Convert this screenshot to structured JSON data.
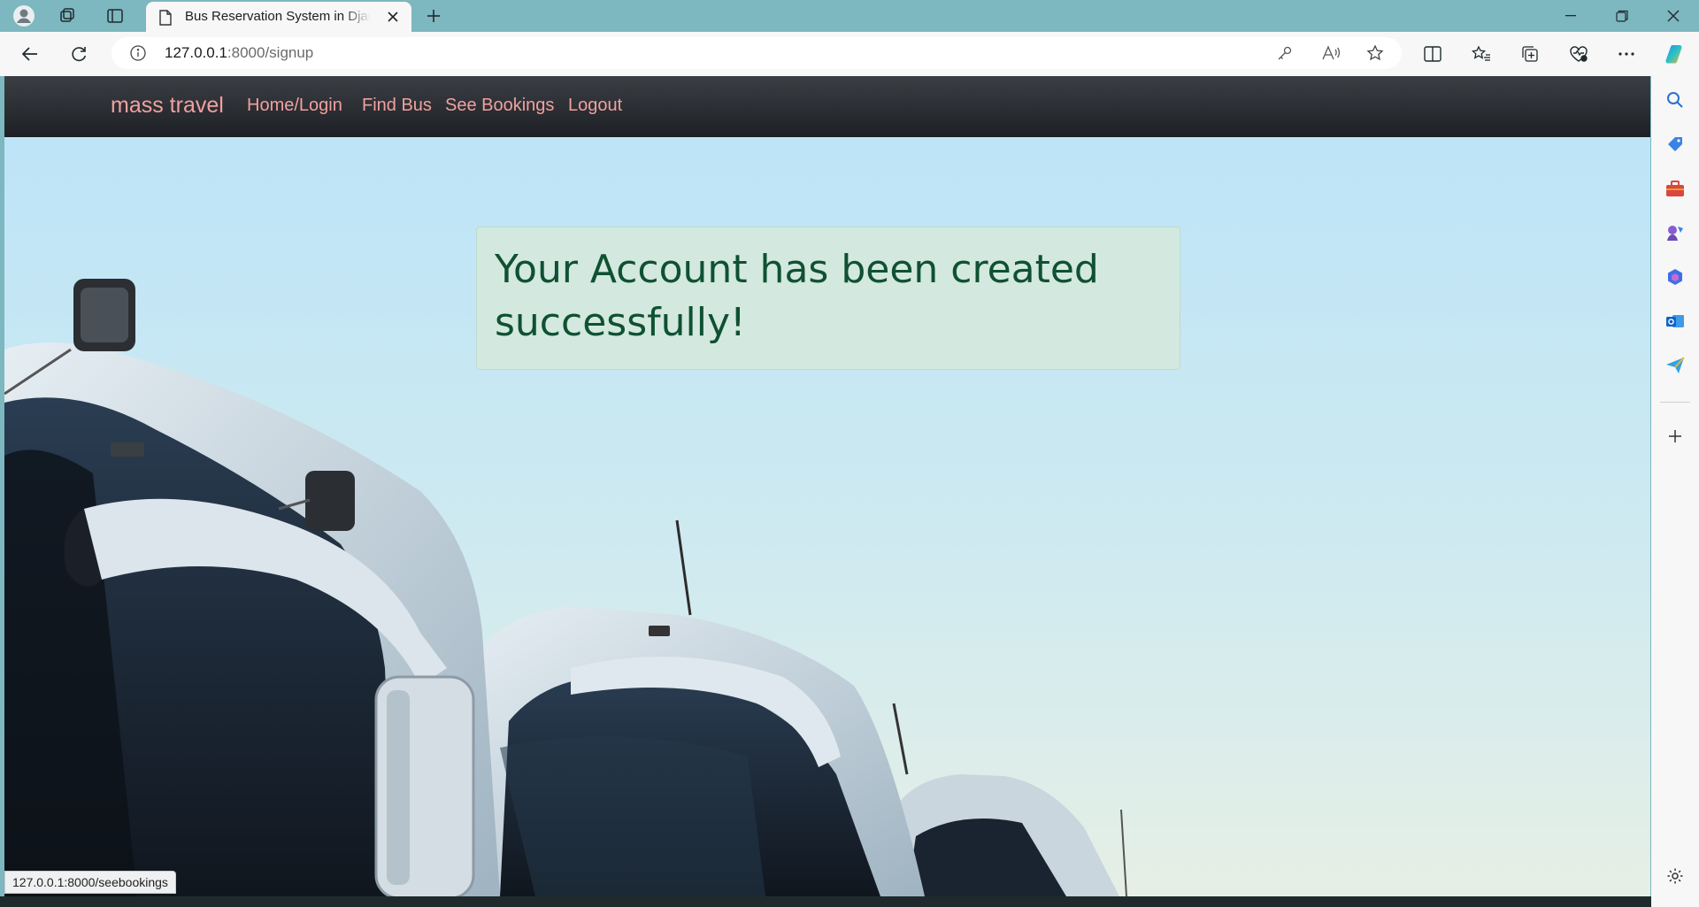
{
  "browser": {
    "tab": {
      "title": "Bus Reservation System in Django"
    },
    "address": {
      "host": "127.0.0.1",
      "rest": ":8000/signup"
    },
    "status_url": "127.0.0.1:8000/seebookings"
  },
  "navbar": {
    "brand": "mass travel",
    "links": [
      {
        "label": "Home/Login"
      },
      {
        "label": "Find Bus"
      },
      {
        "label": "See Bookings"
      },
      {
        "label": "Logout"
      }
    ],
    "link_color": "#f1a0a0"
  },
  "alert": {
    "message": "Your Account has been created successfully!",
    "background": "#d3e8de",
    "text_color": "#0f5132"
  },
  "icons": {
    "tabstrip": [
      "profile-icon",
      "workspaces-icon",
      "tab-actions-icon",
      "page-icon",
      "close-icon",
      "new-tab-icon",
      "minimize-icon",
      "restore-icon",
      "close-window-icon"
    ],
    "toolbar": [
      "back-icon",
      "refresh-icon",
      "info-icon",
      "key-icon",
      "read-aloud-icon",
      "favorite-star-icon",
      "split-screen-icon",
      "favorites-icon",
      "collections-icon",
      "browser-essentials-icon",
      "more-icon",
      "copilot-icon"
    ],
    "sidebar": [
      "search-icon",
      "shopping-tag-icon",
      "toolbox-icon",
      "games-icon",
      "microsoft365-icon",
      "outlook-icon",
      "send-icon",
      "add-icon",
      "settings-icon"
    ]
  }
}
